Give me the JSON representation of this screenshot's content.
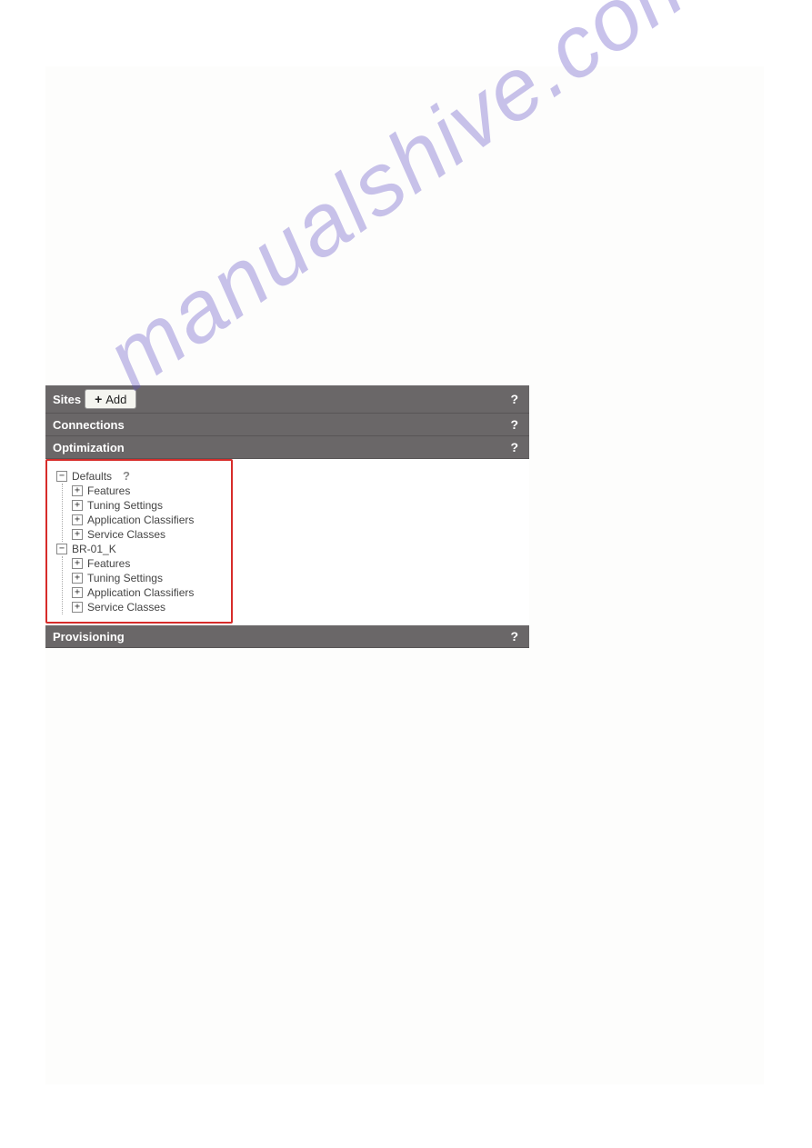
{
  "watermark": "manualshive.com",
  "sections": {
    "sites": {
      "label": "Sites",
      "add_button": "Add",
      "plus": "+"
    },
    "connections": {
      "label": "Connections"
    },
    "optimization": {
      "label": "Optimization"
    },
    "provisioning": {
      "label": "Provisioning"
    }
  },
  "help_symbol": "?",
  "tree": {
    "defaults": {
      "label": "Defaults",
      "help": "?",
      "expand": "−",
      "children": {
        "features": {
          "label": "Features",
          "expand": "+"
        },
        "tuning": {
          "label": "Tuning Settings",
          "expand": "+"
        },
        "classifiers": {
          "label": "Application Classifiers",
          "expand": "+"
        },
        "service": {
          "label": "Service Classes",
          "expand": "+"
        }
      }
    },
    "br01k": {
      "label": "BR-01_K",
      "expand": "−",
      "children": {
        "features": {
          "label": "Features",
          "expand": "+"
        },
        "tuning": {
          "label": "Tuning Settings",
          "expand": "+"
        },
        "classifiers": {
          "label": "Application Classifiers",
          "expand": "+"
        },
        "service": {
          "label": "Service Classes",
          "expand": "+"
        }
      }
    }
  }
}
